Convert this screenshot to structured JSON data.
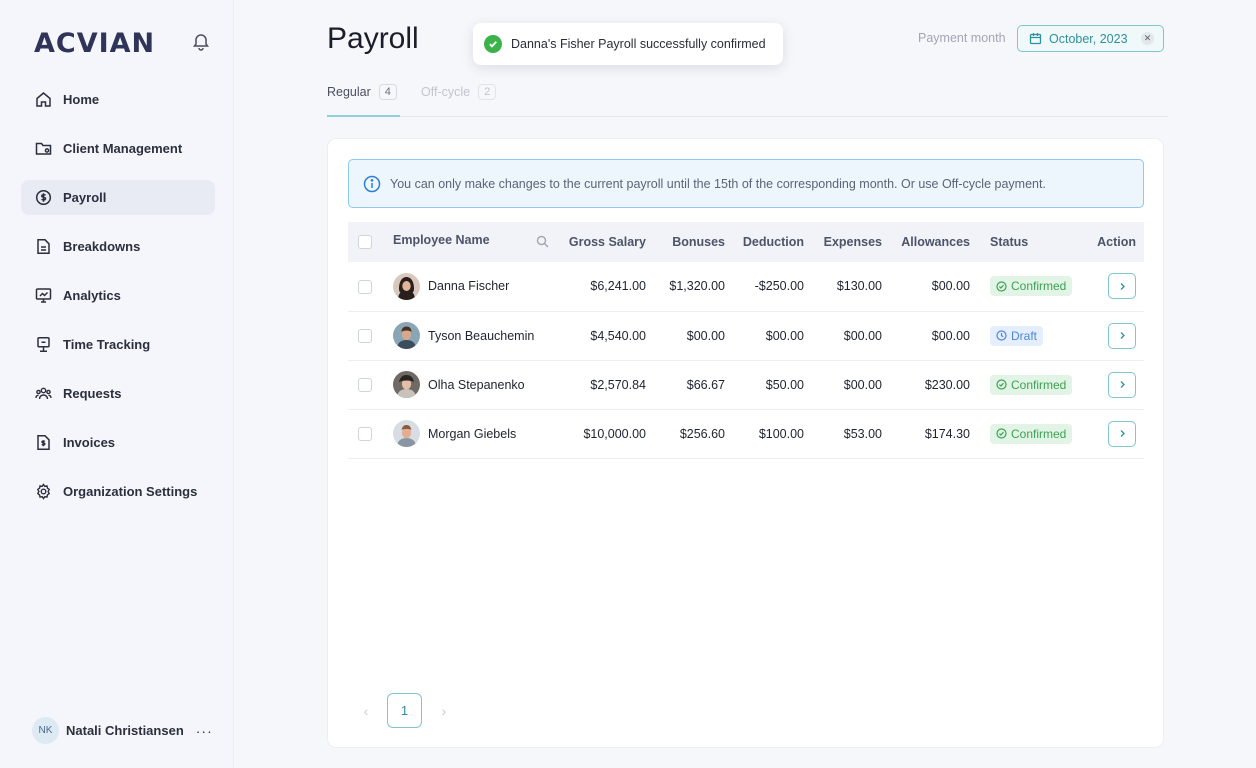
{
  "brand": {
    "logo_text": "ACVIAN"
  },
  "sidebar": {
    "items": [
      {
        "label": "Home",
        "icon": "home-icon",
        "active": false
      },
      {
        "label": "Client Management",
        "icon": "client-folder-icon",
        "active": false
      },
      {
        "label": "Payroll",
        "icon": "dollar-circle-icon",
        "active": true
      },
      {
        "label": "Breakdowns",
        "icon": "document-icon",
        "active": false
      },
      {
        "label": "Analytics",
        "icon": "monitor-chart-icon",
        "active": false
      },
      {
        "label": "Time Tracking",
        "icon": "time-tracking-icon",
        "active": false
      },
      {
        "label": "Requests",
        "icon": "people-icon",
        "active": false
      },
      {
        "label": "Invoices",
        "icon": "invoice-icon",
        "active": false
      },
      {
        "label": "Organization Settings",
        "icon": "gear-icon",
        "active": false
      }
    ],
    "user": {
      "initials": "NK",
      "name": "Natali Christiansen",
      "more": "···"
    }
  },
  "header": {
    "title": "Payroll",
    "toast": "Danna's Fisher Payroll successfully confirmed",
    "payment_month_label": "Payment month",
    "payment_month_value": "October, 2023"
  },
  "tabs": [
    {
      "label": "Regular",
      "count": "4",
      "active": true
    },
    {
      "label": "Off-cycle",
      "count": "2",
      "active": false
    }
  ],
  "info_banner": "You can only make changes to the current payroll until the 15th of the corresponding month. Or use Off-cycle payment.",
  "table": {
    "columns": [
      "Employee Name",
      "Gross Salary",
      "Bonuses",
      "Deduction",
      "Expenses",
      "Allowances",
      "Status",
      "Action"
    ],
    "rows": [
      {
        "name": "Danna Fischer",
        "gross": "$6,241.00",
        "bonuses": "$1,320.00",
        "deduction": "-$250.00",
        "expenses": "$130.00",
        "allowances": "$00.00",
        "status": "Confirmed"
      },
      {
        "name": "Tyson Beauchemin",
        "gross": "$4,540.00",
        "bonuses": "$00.00",
        "deduction": "$00.00",
        "expenses": "$00.00",
        "allowances": "$00.00",
        "status": "Draft"
      },
      {
        "name": "Olha Stepanenko",
        "gross": "$2,570.84",
        "bonuses": "$66.67",
        "deduction": "$50.00",
        "expenses": "$00.00",
        "allowances": "$230.00",
        "status": "Confirmed"
      },
      {
        "name": "Morgan Giebels",
        "gross": "$10,000.00",
        "bonuses": "$256.60",
        "deduction": "$100.00",
        "expenses": "$53.00",
        "allowances": "$174.30",
        "status": "Confirmed"
      }
    ]
  },
  "pagination": {
    "current": "1"
  },
  "colors": {
    "accent": "#2f8f9c",
    "confirmed": "#3ca253",
    "draft": "#4f87d8",
    "info_border": "#8ec9ee"
  }
}
